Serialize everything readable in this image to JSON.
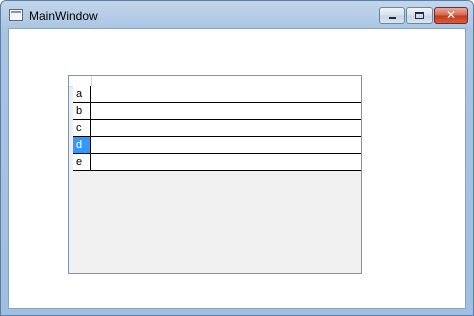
{
  "window": {
    "title": "MainWindow"
  },
  "controls": {
    "close_glyph": "✕"
  },
  "table": {
    "rows": [
      {
        "header": "a",
        "selected": false
      },
      {
        "header": "b",
        "selected": false
      },
      {
        "header": "c",
        "selected": false
      },
      {
        "header": "d",
        "selected": true
      },
      {
        "header": "e",
        "selected": false
      }
    ]
  }
}
